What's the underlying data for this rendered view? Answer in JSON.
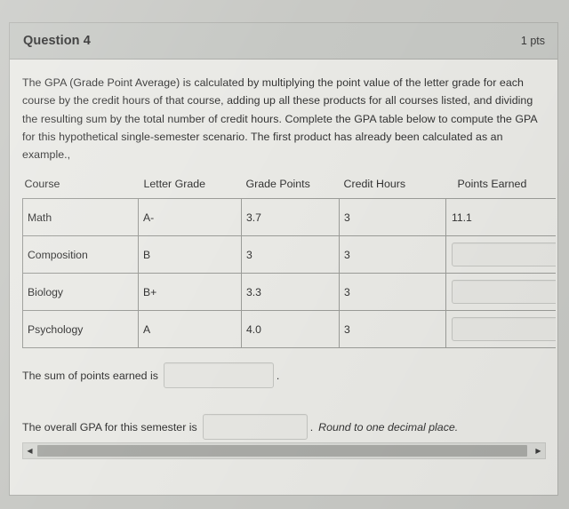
{
  "header": {
    "question_label": "Question 4",
    "points": "1 pts"
  },
  "prompt": "The GPA (Grade Point Average) is calculated by multiplying the point value of the letter grade for each course by the credit hours of that course, adding up all these products for all courses listed, and dividing the resulting sum by the total number of credit hours. Complete the GPA table below to compute the GPA for this hypothetical single-semester scenario. The first product has already been calculated as an example.,",
  "table": {
    "headers": {
      "course": "Course",
      "letter_grade": "Letter Grade",
      "grade_points": "Grade Points",
      "credit_hours": "Credit Hours",
      "points_earned": "Points Earned"
    },
    "rows": [
      {
        "course": "Math",
        "letter_grade": "A-",
        "grade_points": "3.7",
        "credit_hours": "3",
        "points_earned": "11.1",
        "points_earned_is_input": false
      },
      {
        "course": "Composition",
        "letter_grade": "B",
        "grade_points": "3",
        "credit_hours": "3",
        "points_earned": "",
        "points_earned_is_input": true
      },
      {
        "course": "Biology",
        "letter_grade": "B+",
        "grade_points": "3.3",
        "credit_hours": "3",
        "points_earned": "",
        "points_earned_is_input": true
      },
      {
        "course": "Psychology",
        "letter_grade": "A",
        "grade_points": "4.0",
        "credit_hours": "3",
        "points_earned": "",
        "points_earned_is_input": true
      }
    ]
  },
  "answers": {
    "sum_label": "The sum of points earned is",
    "sum_value": "",
    "sum_period": ".",
    "gpa_label": "The overall GPA for this semester is",
    "gpa_value": "",
    "gpa_period": ".",
    "gpa_hint": "Round to one decimal place."
  },
  "scrollbar": {
    "left_arrow": "◀",
    "right_arrow": "▶"
  },
  "colors": {
    "header_bar": "#c6c8c4",
    "card_background": "#e9e9e5",
    "page_background": "#c8c9c5",
    "table_border": "#9b9c98",
    "scroll_thumb": "#a9aaa6"
  }
}
